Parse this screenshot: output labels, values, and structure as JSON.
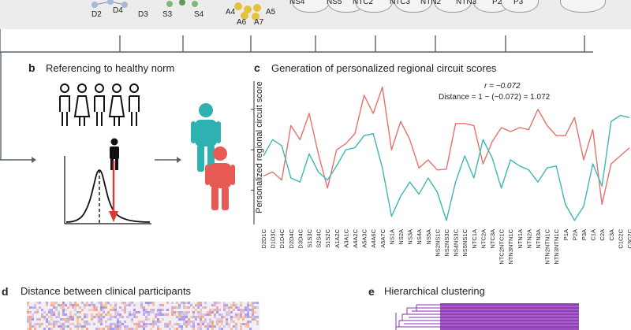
{
  "top_labels": [
    "D2",
    "D4",
    "D3",
    "S3",
    "S4",
    "A4",
    "A5",
    "A6",
    "A7",
    "NS4",
    "NS5",
    "NTC2",
    "NTC3",
    "NTN2",
    "NTN3",
    "P2",
    "P3"
  ],
  "panel_b": {
    "letter": "b",
    "title": "Referencing to healthy norm"
  },
  "panel_c": {
    "letter": "c",
    "title": "Generation of personalized regional circuit scores",
    "r_text": "r = −0.072",
    "distance_text": "Distance = 1 − (−0.072) = 1.072"
  },
  "panel_d": {
    "letter": "d",
    "title": "Distance between clinical participants"
  },
  "panel_e": {
    "letter": "e",
    "title": "Hierarchical clustering"
  },
  "colors": {
    "red_series": "#e8706b",
    "teal_series": "#3cb8b0",
    "person_teal": "#2eb1b1",
    "person_red": "#e85a55",
    "heatmap_blue": "#9a8ee8",
    "heatmap_orange": "#f0a07a",
    "dendrogram": "#8a2fb5"
  },
  "chart_data": {
    "type": "line",
    "ylabel": "Personalized regional circuit score",
    "ylim": [
      -1.85,
      1.7
    ],
    "yticks": [
      -1,
      0,
      1
    ],
    "categories": [
      "D2D1C",
      "D1D3C",
      "D1D4C",
      "D2D4C",
      "D3D4C",
      "S1S3C",
      "S2S4C",
      "S1S2C",
      "A1A2C",
      "A3A1C",
      "A4A2C",
      "A5A3C",
      "A4A6C",
      "A5A7C",
      "NS1A",
      "NS2A",
      "NS3A",
      "NS4A",
      "NS5A",
      "NS2NS1C",
      "NS2NS3C",
      "NS4NS3C",
      "NS5NS1C",
      "NTC1A",
      "NTC2A",
      "NTC3A",
      "NTC2NTC1C",
      "NTN3NTN1C",
      "NTN1A",
      "NTN2A",
      "NTN3A",
      "NTN2NTN1C",
      "NTN3NTN1C",
      "P1A",
      "P2A",
      "P3A",
      "C1A",
      "C2A",
      "C3A",
      "C1C2C",
      "C3C2C"
    ],
    "series": [
      {
        "values": [
          -0.65,
          -0.55,
          -0.75,
          0.6,
          0.25,
          0.9,
          -0.1,
          -0.95,
          0.0,
          0.15,
          0.4,
          1.35,
          0.9,
          1.55,
          0.0,
          0.7,
          0.25,
          -0.45,
          -0.25,
          -0.5,
          -0.48,
          0.65,
          0.65,
          0.6,
          -0.35,
          0.2,
          0.55,
          0.45,
          0.55,
          0.5,
          1.0,
          0.6,
          0.35,
          0.35,
          0.8,
          -0.25,
          0.5,
          -1.35,
          -0.35,
          -0.15,
          0.05
        ]
      },
      {
        "values": [
          -0.15,
          0.25,
          0.1,
          -0.7,
          -0.8,
          -0.1,
          -0.55,
          -0.75,
          -0.4,
          0.0,
          0.05,
          0.35,
          0.4,
          -0.45,
          -1.65,
          -1.15,
          -0.8,
          -1.1,
          -0.7,
          -1.05,
          -1.75,
          -0.8,
          -0.15,
          -0.7,
          0.25,
          -0.2,
          -0.95,
          -0.25,
          -0.4,
          -0.5,
          -0.8,
          -0.45,
          -0.4,
          -1.35,
          -1.75,
          -1.4,
          -0.35,
          -0.9,
          0.7,
          0.85,
          0.8
        ]
      }
    ]
  }
}
